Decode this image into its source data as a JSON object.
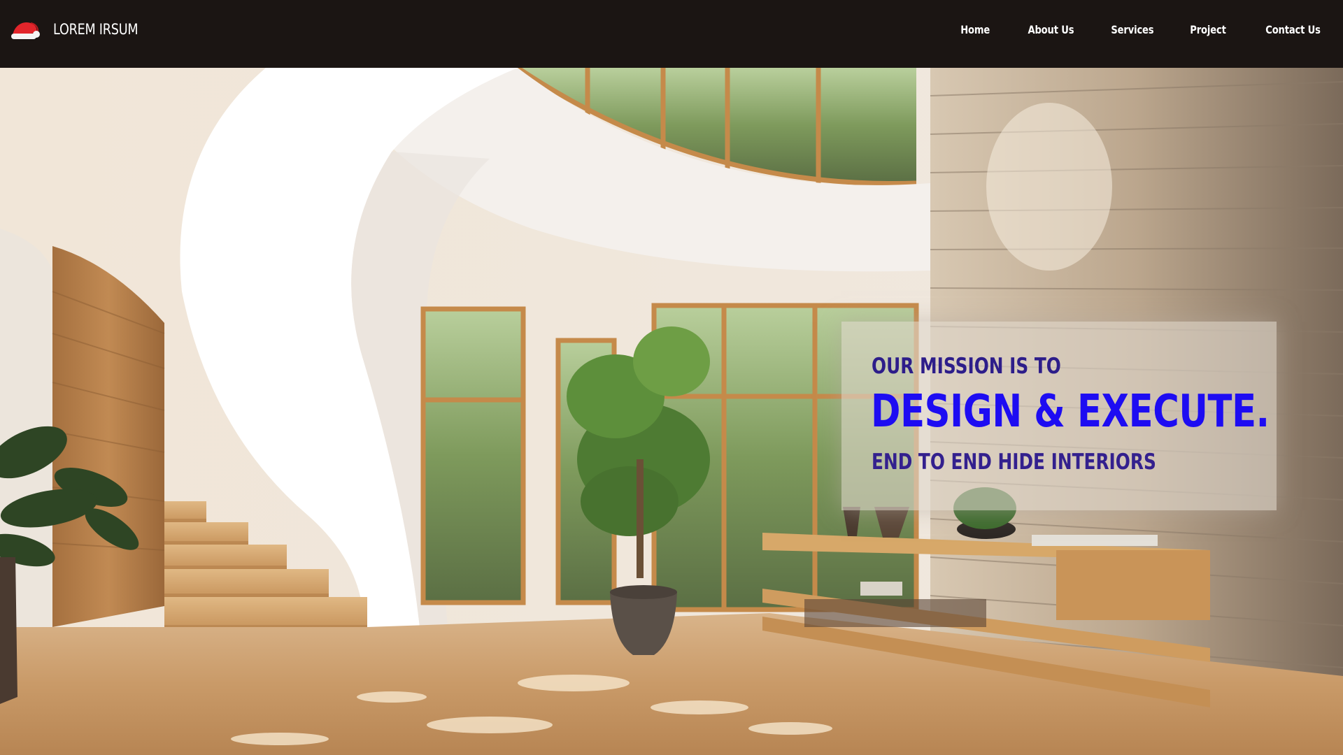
{
  "header": {
    "brand_name": "LOREM IRSUM",
    "logo_icon": "santa-hat-icon",
    "nav": [
      {
        "label": "Home"
      },
      {
        "label": "About Us"
      },
      {
        "label": "Services"
      },
      {
        "label": "Project"
      },
      {
        "label": "Contact Us"
      }
    ]
  },
  "hero": {
    "background": "interior-photo: curved white staircase, tall wood-framed windows, potted tree, stone wall, floating wooden console",
    "mission": {
      "kicker": "OUR MISSION IS TO",
      "headline": "DESIGN & EXECUTE.",
      "sub": "END TO END HIDE INTERIORS"
    }
  },
  "colors": {
    "header_bg": "#1b1513",
    "nav_text": "#ffffff",
    "headline": "#1d0cf2",
    "kicker": "#2d1d8a",
    "card_bg": "#ded6cc"
  }
}
